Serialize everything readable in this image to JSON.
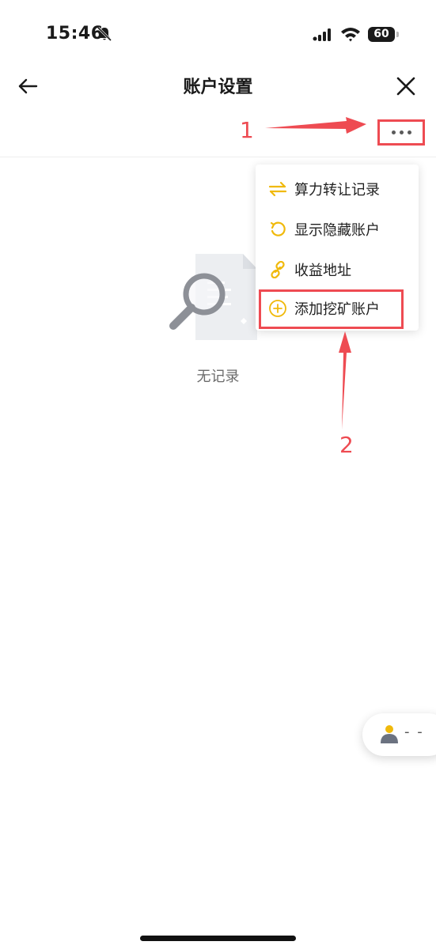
{
  "status_bar": {
    "time": "15:46",
    "battery": "60"
  },
  "header": {
    "title": "账户设置"
  },
  "menu": {
    "items": [
      {
        "label": "算力转让记录",
        "icon": "transfer-icon"
      },
      {
        "label": "显示隐藏账户",
        "icon": "undo-icon"
      },
      {
        "label": "收益地址",
        "icon": "link-icon"
      },
      {
        "label": "添加挖矿账户",
        "icon": "plus-circle-icon"
      }
    ]
  },
  "empty_state": {
    "text": "无记录"
  },
  "annotations": {
    "step1": "1",
    "step2": "2"
  },
  "user_pill": {
    "text": "- -"
  },
  "colors": {
    "accent": "#f0b90b",
    "annotation": "#ee4b52",
    "text": "#1f1f1f",
    "muted": "#6b6b6b"
  }
}
